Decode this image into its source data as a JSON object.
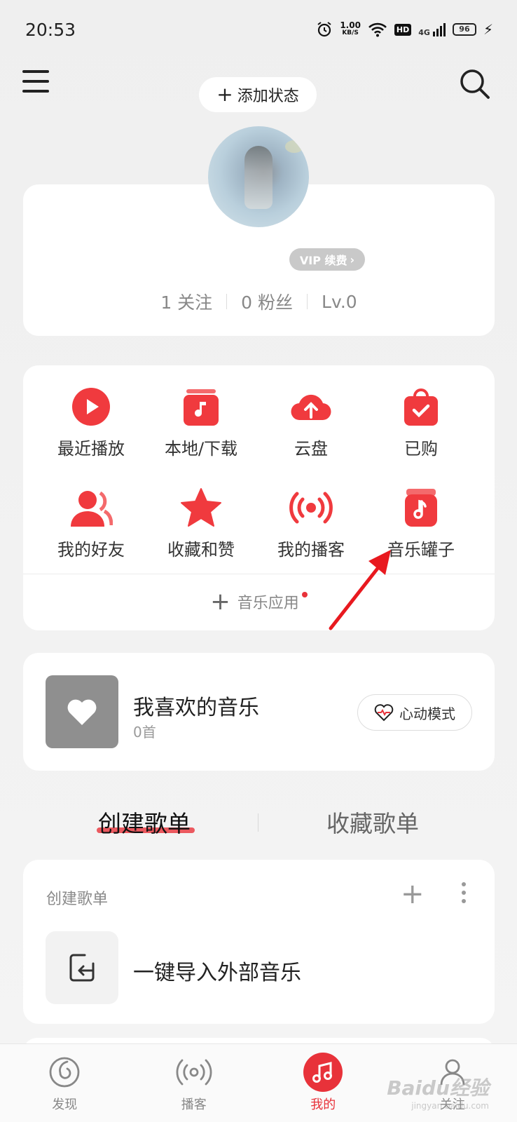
{
  "status_bar": {
    "time": "20:53",
    "net_speed_value": "1.00",
    "net_speed_unit": "KB/S",
    "hd": "HD",
    "network": "4G",
    "battery": "96"
  },
  "header": {
    "add_status": "添加状态"
  },
  "profile": {
    "vip_badge": "VIP 续费",
    "follow": "1 关注",
    "fans": "0 粉丝",
    "level": "Lv.0"
  },
  "grid": {
    "items": [
      {
        "label": "最近播放",
        "icon": "play-circle-icon"
      },
      {
        "label": "本地/下载",
        "icon": "music-box-icon"
      },
      {
        "label": "云盘",
        "icon": "cloud-upload-icon"
      },
      {
        "label": "已购",
        "icon": "shopping-bag-icon"
      },
      {
        "label": "我的好友",
        "icon": "friends-icon"
      },
      {
        "label": "收藏和赞",
        "icon": "star-icon"
      },
      {
        "label": "我的播客",
        "icon": "podcast-icon"
      },
      {
        "label": "音乐罐子",
        "icon": "music-jar-icon"
      }
    ],
    "apps_label": "音乐应用"
  },
  "liked": {
    "title": "我喜欢的音乐",
    "count": "0首",
    "heart_mode": "心动模式"
  },
  "tabs": {
    "create": "创建歌单",
    "favorite": "收藏歌单"
  },
  "playlists": {
    "header": "创建歌单",
    "import_label": "一键导入外部音乐"
  },
  "bottom_nav": {
    "items": [
      {
        "label": "发现",
        "icon": "discover-icon",
        "active": false
      },
      {
        "label": "播客",
        "icon": "podcast-icon",
        "active": false
      },
      {
        "label": "我的",
        "icon": "music-note-icon",
        "active": true
      },
      {
        "label": "关注",
        "icon": "user-icon",
        "active": false
      }
    ]
  },
  "watermark": {
    "text": "Baidu经验",
    "sub": "jingyan.baidu.com"
  },
  "colors": {
    "accent": "#e8323a",
    "background": "#f2f2f2",
    "card": "#ffffff"
  }
}
